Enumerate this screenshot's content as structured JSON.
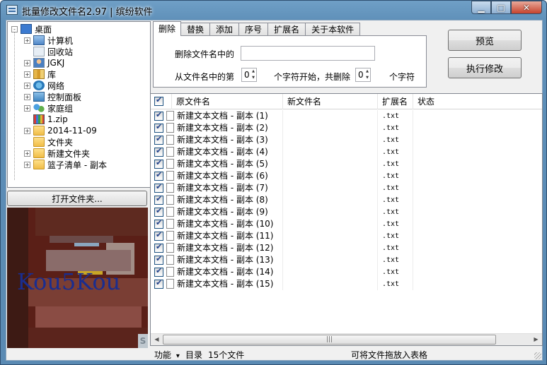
{
  "window": {
    "title": "批量修改文件名2.97 | 缤纷软件",
    "controls": [
      "minimize",
      "maximize",
      "close"
    ]
  },
  "tree": {
    "items": [
      {
        "label": "桌面",
        "icon": "desktop-icon",
        "expander": "-",
        "level": 0
      },
      {
        "label": "计算机",
        "icon": "computer-icon",
        "expander": "+",
        "level": 1
      },
      {
        "label": "回收站",
        "icon": "recycle-bin-icon",
        "expander": "",
        "level": 1
      },
      {
        "label": "JGKJ",
        "icon": "user-icon",
        "expander": "+",
        "level": 1
      },
      {
        "label": "库",
        "icon": "library-icon",
        "expander": "+",
        "level": 1
      },
      {
        "label": "网络",
        "icon": "network-icon",
        "expander": "+",
        "level": 1
      },
      {
        "label": "控制面板",
        "icon": "control-panel-icon",
        "expander": "+",
        "level": 1
      },
      {
        "label": "家庭组",
        "icon": "homegroup-icon",
        "expander": "+",
        "level": 1
      },
      {
        "label": "1.zip",
        "icon": "zip-icon",
        "expander": "",
        "level": 1
      },
      {
        "label": "2014-11-09",
        "icon": "folder-icon",
        "expander": "+",
        "level": 1
      },
      {
        "label": "文件夹",
        "icon": "folder-icon",
        "expander": "",
        "level": 1
      },
      {
        "label": "新建文件夹",
        "icon": "folder-icon",
        "expander": "+",
        "level": 1
      },
      {
        "label": "篮子清单 - 副本",
        "icon": "folder-icon",
        "expander": "+",
        "level": 1
      }
    ],
    "open_folder_label": "打开文件夹..."
  },
  "preview": {
    "overlay_text": "Kou5Kou",
    "corner_text": "S"
  },
  "tabs": {
    "items": [
      "删除",
      "替换",
      "添加",
      "序号",
      "扩展名",
      "关于本软件"
    ],
    "active": "删除"
  },
  "delete_panel": {
    "label_contains": "删除文件名中的",
    "contains_value": "",
    "label_from": "从文件名中的第",
    "start_value": "0",
    "label_mid": "个字符开始，共删除",
    "count_value": "0",
    "label_end": "个字符"
  },
  "actions": {
    "preview_label": "预览",
    "execute_label": "执行修改"
  },
  "grid": {
    "columns": [
      "原文件名",
      "新文件名",
      "扩展名",
      "状态"
    ],
    "header_checked": true,
    "rows": [
      {
        "checked": true,
        "original": "新建文本文档 - 副本 (1)",
        "new": "",
        "ext": ".txt",
        "status": ""
      },
      {
        "checked": true,
        "original": "新建文本文档 - 副本 (2)",
        "new": "",
        "ext": ".txt",
        "status": ""
      },
      {
        "checked": true,
        "original": "新建文本文档 - 副本 (3)",
        "new": "",
        "ext": ".txt",
        "status": ""
      },
      {
        "checked": true,
        "original": "新建文本文档 - 副本 (4)",
        "new": "",
        "ext": ".txt",
        "status": ""
      },
      {
        "checked": true,
        "original": "新建文本文档 - 副本 (5)",
        "new": "",
        "ext": ".txt",
        "status": ""
      },
      {
        "checked": true,
        "original": "新建文本文档 - 副本 (6)",
        "new": "",
        "ext": ".txt",
        "status": ""
      },
      {
        "checked": true,
        "original": "新建文本文档 - 副本 (7)",
        "new": "",
        "ext": ".txt",
        "status": ""
      },
      {
        "checked": true,
        "original": "新建文本文档 - 副本 (8)",
        "new": "",
        "ext": ".txt",
        "status": ""
      },
      {
        "checked": true,
        "original": "新建文本文档 - 副本 (9)",
        "new": "",
        "ext": ".txt",
        "status": ""
      },
      {
        "checked": true,
        "original": "新建文本文档 - 副本 (10)",
        "new": "",
        "ext": ".txt",
        "status": ""
      },
      {
        "checked": true,
        "original": "新建文本文档 - 副本 (11)",
        "new": "",
        "ext": ".txt",
        "status": ""
      },
      {
        "checked": true,
        "original": "新建文本文档 - 副本 (12)",
        "new": "",
        "ext": ".txt",
        "status": ""
      },
      {
        "checked": true,
        "original": "新建文本文档 - 副本 (13)",
        "new": "",
        "ext": ".txt",
        "status": ""
      },
      {
        "checked": true,
        "original": "新建文本文档 - 副本 (14)",
        "new": "",
        "ext": ".txt",
        "status": ""
      },
      {
        "checked": true,
        "original": "新建文本文档 - 副本 (15)",
        "new": "",
        "ext": ".txt",
        "status": ""
      }
    ]
  },
  "statusbar": {
    "function_label": "功能",
    "dropdown_arrow": "▾",
    "directory_label": "目录",
    "file_count": "15个文件",
    "hint": "可将文件拖放入表格"
  },
  "colors": {
    "titlebar": "#5e8fb8",
    "checkmark": "#1f3f8a",
    "panel_bg": "#f0f0f0"
  }
}
